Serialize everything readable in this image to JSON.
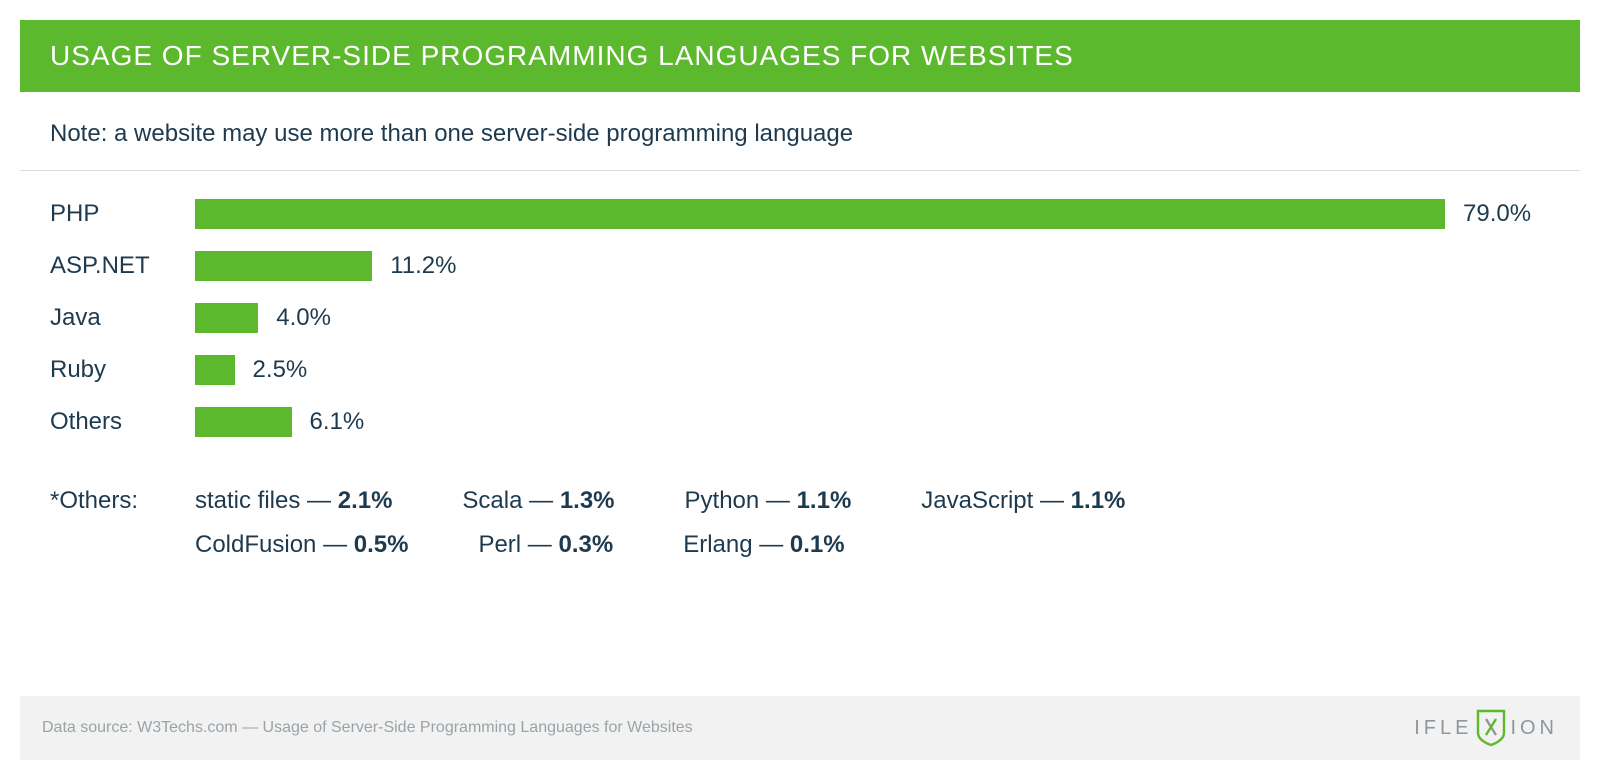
{
  "title": "USAGE OF SERVER-SIDE PROGRAMMING LANGUAGES FOR WEBSITES",
  "note": "Note: a website may use more than one server-side programming language",
  "chart_data": {
    "type": "bar",
    "categories": [
      "PHP",
      "ASP.NET",
      "Java",
      "Ruby",
      "Others"
    ],
    "values": [
      79.0,
      11.2,
      4.0,
      2.5,
      6.1
    ],
    "value_labels": [
      "79.0%",
      "11.2%",
      "4.0%",
      "2.5%",
      "6.1%"
    ],
    "max": 79.0,
    "bar_color": "#5cb82c"
  },
  "others": {
    "label": "*Others:",
    "row1": [
      {
        "name": "static files",
        "pct": "2.1%"
      },
      {
        "name": "Scala",
        "pct": "1.3%"
      },
      {
        "name": "Python",
        "pct": "1.1%"
      },
      {
        "name": "JavaScript",
        "pct": "1.1%"
      }
    ],
    "row2": [
      {
        "name": "ColdFusion",
        "pct": "0.5%"
      },
      {
        "name": "Perl",
        "pct": "0.3%"
      },
      {
        "name": "Erlang",
        "pct": "0.1%"
      }
    ]
  },
  "footer": {
    "source": "Data source: W3Techs.com — Usage of Server-Side Programming Languages for Websites",
    "logo_left": "IFLE",
    "logo_right": "ION"
  }
}
